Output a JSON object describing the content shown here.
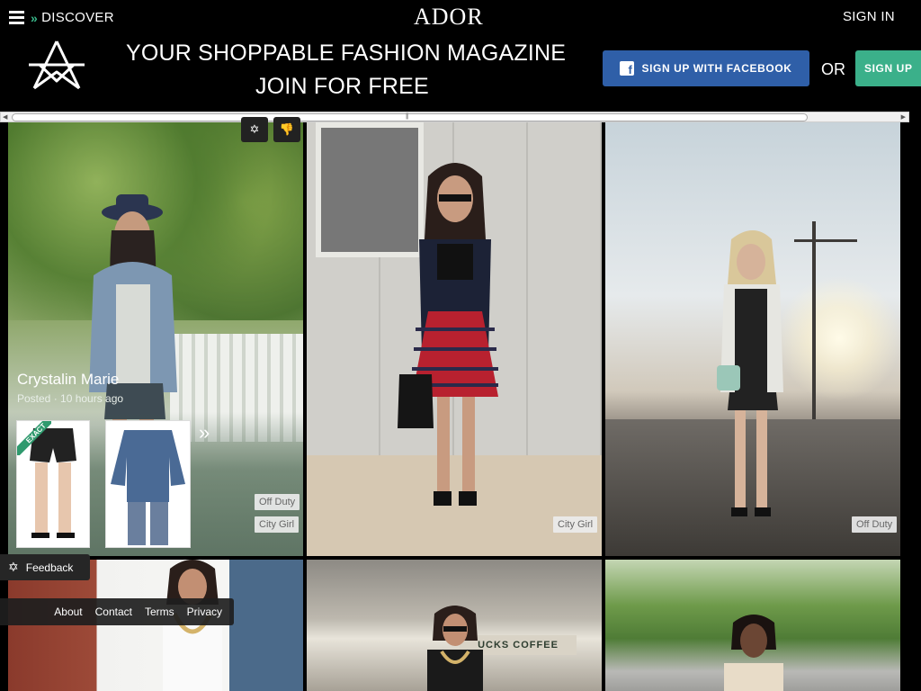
{
  "header": {
    "discover_label": "DISCOVER",
    "brand": "ADOR",
    "signin_label": "SIGN IN",
    "tagline_line1": "YOUR SHOPPABLE FASHION MAGAZINE",
    "tagline_line2": "JOIN FOR FREE",
    "facebook_signup_label": "SIGN UP WITH FACEBOOK",
    "or_label": "OR",
    "signup_label": "SIGN UP",
    "icons": [
      "menu-icon",
      "chevron-double-right-icon",
      "ador-logo-icon",
      "facebook-icon"
    ]
  },
  "colors": {
    "accent_green": "#39b88a",
    "facebook_blue": "#2f5fa8",
    "signup_green": "#3bb08a"
  },
  "feed": {
    "tile_actions": [
      "ador-star-icon",
      "thumbs-down-icon"
    ],
    "posts": [
      {
        "author": "Crystalin Marie",
        "posted": "Posted · 10 hours ago",
        "exact_badge": "EXACT",
        "tags": [
          "Off Duty",
          "City Girl"
        ]
      },
      {
        "tags": [
          "City Girl"
        ]
      },
      {
        "tags": [
          "Off Duty"
        ]
      },
      {},
      {
        "sign_text": "UCKS COFFEE"
      },
      {}
    ]
  },
  "feedback": {
    "label": "Feedback"
  },
  "footer": {
    "links": [
      "About",
      "Contact",
      "Terms",
      "Privacy"
    ]
  }
}
